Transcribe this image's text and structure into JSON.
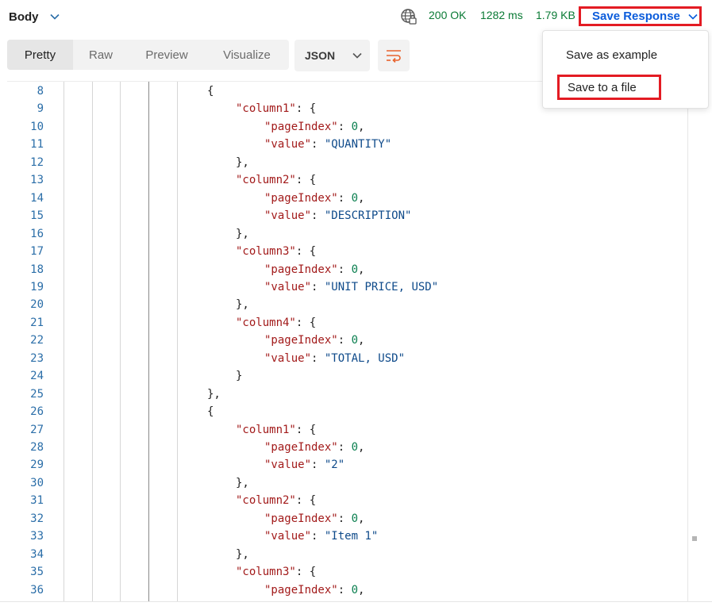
{
  "header": {
    "body_label": "Body",
    "status": "200 OK",
    "time": "1282 ms",
    "size": "1.79 KB",
    "save_response_label": "Save Response"
  },
  "toolbar": {
    "tabs": [
      "Pretty",
      "Raw",
      "Preview",
      "Visualize"
    ],
    "active_tab": "Pretty",
    "format": "JSON"
  },
  "menu": {
    "items": [
      "Save as example",
      "Save to a file"
    ]
  },
  "colors": {
    "status_green": "#0a7a35",
    "accent_blue": "#0b5cdb",
    "highlight_red": "#e31b23",
    "wrap_icon": "#e8622c"
  },
  "code": {
    "lines": [
      {
        "n": "8",
        "indent": 0,
        "parts": [
          [
            "p",
            "{"
          ]
        ]
      },
      {
        "n": "9",
        "indent": 1,
        "parts": [
          [
            "k",
            "\"column1\""
          ],
          [
            "p",
            ": {"
          ]
        ]
      },
      {
        "n": "10",
        "indent": 2,
        "parts": [
          [
            "k",
            "\"pageIndex\""
          ],
          [
            "p",
            ": "
          ],
          [
            "n",
            "0"
          ],
          [
            "p",
            ","
          ]
        ]
      },
      {
        "n": "11",
        "indent": 2,
        "parts": [
          [
            "k",
            "\"value\""
          ],
          [
            "p",
            ": "
          ],
          [
            "s",
            "\"QUANTITY\""
          ]
        ]
      },
      {
        "n": "12",
        "indent": 1,
        "parts": [
          [
            "p",
            "},"
          ]
        ]
      },
      {
        "n": "13",
        "indent": 1,
        "parts": [
          [
            "k",
            "\"column2\""
          ],
          [
            "p",
            ": {"
          ]
        ]
      },
      {
        "n": "14",
        "indent": 2,
        "parts": [
          [
            "k",
            "\"pageIndex\""
          ],
          [
            "p",
            ": "
          ],
          [
            "n",
            "0"
          ],
          [
            "p",
            ","
          ]
        ]
      },
      {
        "n": "15",
        "indent": 2,
        "parts": [
          [
            "k",
            "\"value\""
          ],
          [
            "p",
            ": "
          ],
          [
            "s",
            "\"DESCRIPTION\""
          ]
        ]
      },
      {
        "n": "16",
        "indent": 1,
        "parts": [
          [
            "p",
            "},"
          ]
        ]
      },
      {
        "n": "17",
        "indent": 1,
        "parts": [
          [
            "k",
            "\"column3\""
          ],
          [
            "p",
            ": {"
          ]
        ]
      },
      {
        "n": "18",
        "indent": 2,
        "parts": [
          [
            "k",
            "\"pageIndex\""
          ],
          [
            "p",
            ": "
          ],
          [
            "n",
            "0"
          ],
          [
            "p",
            ","
          ]
        ]
      },
      {
        "n": "19",
        "indent": 2,
        "parts": [
          [
            "k",
            "\"value\""
          ],
          [
            "p",
            ": "
          ],
          [
            "s",
            "\"UNIT PRICE, USD\""
          ]
        ]
      },
      {
        "n": "20",
        "indent": 1,
        "parts": [
          [
            "p",
            "},"
          ]
        ]
      },
      {
        "n": "21",
        "indent": 1,
        "parts": [
          [
            "k",
            "\"column4\""
          ],
          [
            "p",
            ": {"
          ]
        ]
      },
      {
        "n": "22",
        "indent": 2,
        "parts": [
          [
            "k",
            "\"pageIndex\""
          ],
          [
            "p",
            ": "
          ],
          [
            "n",
            "0"
          ],
          [
            "p",
            ","
          ]
        ]
      },
      {
        "n": "23",
        "indent": 2,
        "parts": [
          [
            "k",
            "\"value\""
          ],
          [
            "p",
            ": "
          ],
          [
            "s",
            "\"TOTAL, USD\""
          ]
        ]
      },
      {
        "n": "24",
        "indent": 1,
        "parts": [
          [
            "p",
            "}"
          ]
        ]
      },
      {
        "n": "25",
        "indent": 0,
        "parts": [
          [
            "p",
            "},"
          ]
        ]
      },
      {
        "n": "26",
        "indent": 0,
        "parts": [
          [
            "p",
            "{"
          ]
        ]
      },
      {
        "n": "27",
        "indent": 1,
        "parts": [
          [
            "k",
            "\"column1\""
          ],
          [
            "p",
            ": {"
          ]
        ]
      },
      {
        "n": "28",
        "indent": 2,
        "parts": [
          [
            "k",
            "\"pageIndex\""
          ],
          [
            "p",
            ": "
          ],
          [
            "n",
            "0"
          ],
          [
            "p",
            ","
          ]
        ]
      },
      {
        "n": "29",
        "indent": 2,
        "parts": [
          [
            "k",
            "\"value\""
          ],
          [
            "p",
            ": "
          ],
          [
            "s",
            "\"2\""
          ]
        ]
      },
      {
        "n": "30",
        "indent": 1,
        "parts": [
          [
            "p",
            "},"
          ]
        ]
      },
      {
        "n": "31",
        "indent": 1,
        "parts": [
          [
            "k",
            "\"column2\""
          ],
          [
            "p",
            ": {"
          ]
        ]
      },
      {
        "n": "32",
        "indent": 2,
        "parts": [
          [
            "k",
            "\"pageIndex\""
          ],
          [
            "p",
            ": "
          ],
          [
            "n",
            "0"
          ],
          [
            "p",
            ","
          ]
        ]
      },
      {
        "n": "33",
        "indent": 2,
        "parts": [
          [
            "k",
            "\"value\""
          ],
          [
            "p",
            ": "
          ],
          [
            "s",
            "\"Item 1\""
          ]
        ]
      },
      {
        "n": "34",
        "indent": 1,
        "parts": [
          [
            "p",
            "},"
          ]
        ]
      },
      {
        "n": "35",
        "indent": 1,
        "parts": [
          [
            "k",
            "\"column3\""
          ],
          [
            "p",
            ": {"
          ]
        ]
      },
      {
        "n": "36",
        "indent": 2,
        "parts": [
          [
            "k",
            "\"pageIndex\""
          ],
          [
            "p",
            ": "
          ],
          [
            "n",
            "0"
          ],
          [
            "p",
            ","
          ]
        ]
      }
    ]
  }
}
